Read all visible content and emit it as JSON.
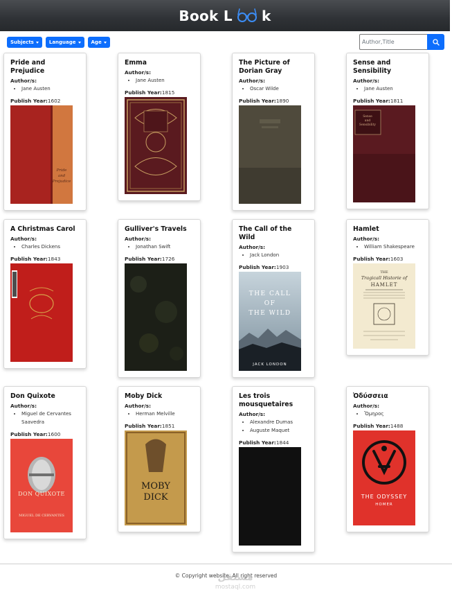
{
  "header": {
    "brand_prefix": "Book L",
    "brand_suffix": "k"
  },
  "filters": {
    "subjects": "Subjects",
    "language": "Language",
    "age": "Age"
  },
  "search": {
    "placeholder": "Author,Title"
  },
  "labels": {
    "authors": "Author/s:",
    "publish_year": "Publish Year:"
  },
  "books": [
    {
      "title": "Pride and Prejudice",
      "authors": [
        "Jane Austen"
      ],
      "year": "1602"
    },
    {
      "title": "Emma",
      "authors": [
        "Jane Austen"
      ],
      "year": "1815"
    },
    {
      "title": "The Picture of Dorian Gray",
      "authors": [
        "Oscar Wilde"
      ],
      "year": "1890"
    },
    {
      "title": "Sense and Sensibility",
      "authors": [
        "Jane Austen"
      ],
      "year": "1811"
    },
    {
      "title": "A Christmas Carol",
      "authors": [
        "Charles Dickens"
      ],
      "year": "1843"
    },
    {
      "title": "Gulliver's Travels",
      "authors": [
        "Jonathan Swift"
      ],
      "year": "1726"
    },
    {
      "title": "The Call of the Wild",
      "authors": [
        "Jack London"
      ],
      "year": "1903"
    },
    {
      "title": "Hamlet",
      "authors": [
        "William Shakespeare"
      ],
      "year": "1603"
    },
    {
      "title": "Don Quixote",
      "authors": [
        "Miguel de Cervantes Saavedra"
      ],
      "year": "1600"
    },
    {
      "title": "Moby Dick",
      "authors": [
        "Herman Melville"
      ],
      "year": "1851"
    },
    {
      "title": "Les trois mousquetaires",
      "authors": [
        "Alexandre Dumas",
        "Auguste Maquet"
      ],
      "year": "1844"
    },
    {
      "title": "Ὀδύσσεια",
      "authors": [
        "Ὅμηρος"
      ],
      "year": "1488"
    }
  ],
  "footer": {
    "copyright": "© Copyright website. All right reserved"
  },
  "watermark": {
    "arabic": "مستقل",
    "latin": "mostaql.com"
  },
  "colors": {
    "navbar": "#2f3236",
    "primary": "#0d6efd",
    "glasses": "#3c8df5"
  }
}
